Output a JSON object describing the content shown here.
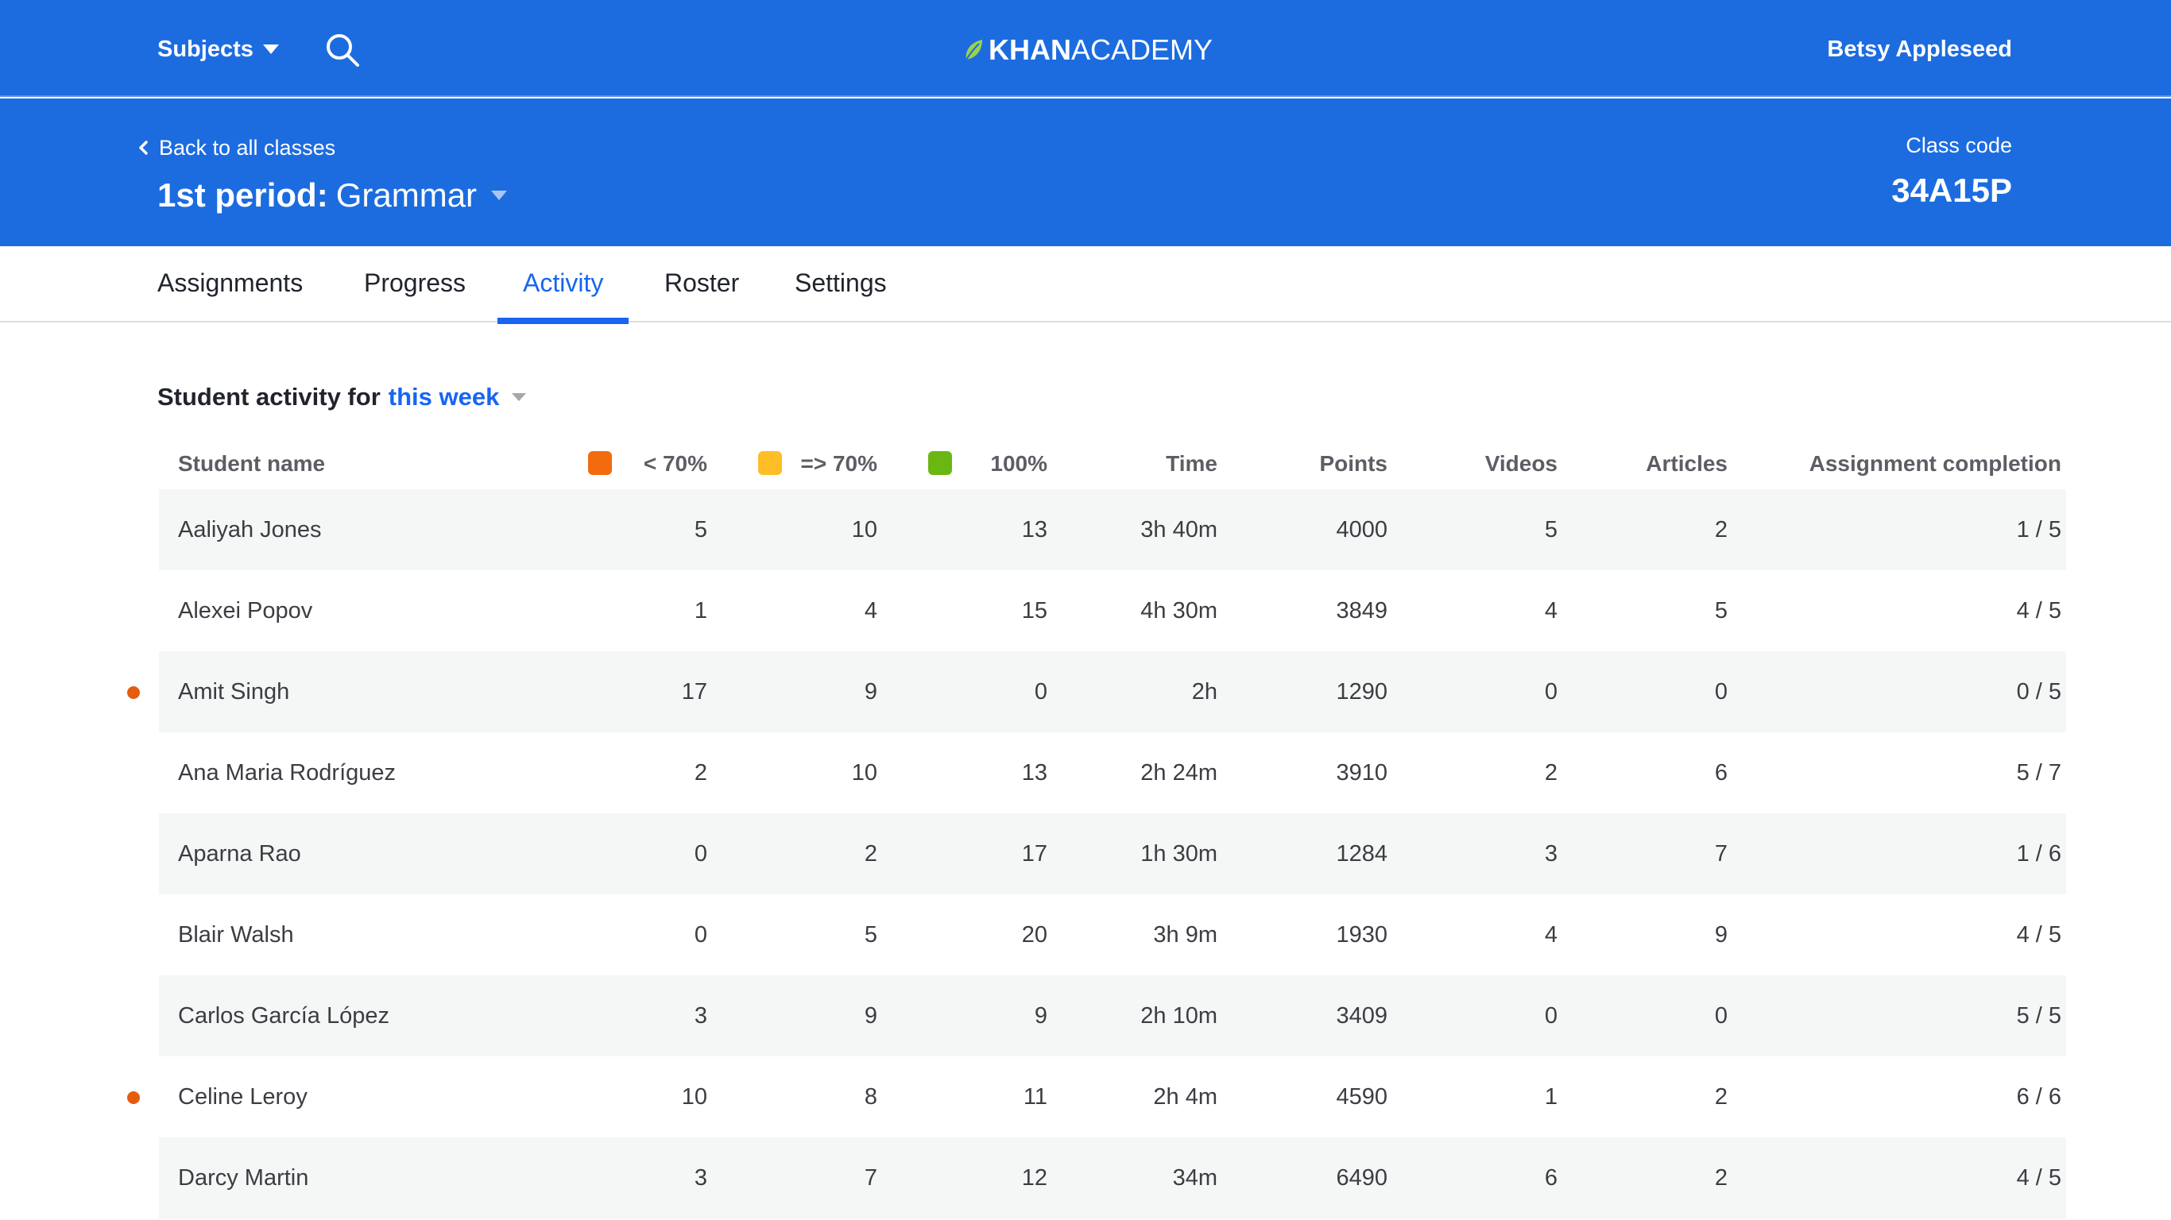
{
  "topbar": {
    "subjects_label": "Subjects",
    "logo_khan": "KHAN",
    "logo_academy": "ACADEMY",
    "user_name": "Betsy Appleseed"
  },
  "class_header": {
    "back_label": "Back to all classes",
    "period": "1st period:",
    "class_name": "Grammar",
    "class_code_label": "Class code",
    "class_code": "34A15P"
  },
  "tabs": [
    {
      "label": "Assignments",
      "active": false
    },
    {
      "label": "Progress",
      "active": false
    },
    {
      "label": "Activity",
      "active": true
    },
    {
      "label": "Roster",
      "active": false
    },
    {
      "label": "Settings",
      "active": false
    }
  ],
  "activity": {
    "title_prefix": "Student activity for",
    "period_value": "this week"
  },
  "colors": {
    "brand_blue": "#1c6ce0",
    "tab_active": "#1865f2",
    "below_70": "#f26b0f",
    "at_or_above_70": "#ffbe26",
    "perfect": "#6ab713",
    "alert_dot": "#e35c10"
  },
  "table": {
    "headers": {
      "student": "Student name",
      "below70": "< 70%",
      "above70": "=> 70%",
      "perfect": "100%",
      "time": "Time",
      "points": "Points",
      "videos": "Videos",
      "articles": "Articles",
      "completion": "Assignment completion"
    },
    "rows": [
      {
        "name": "Aaliyah Jones",
        "below70": "5",
        "above70": "10",
        "perfect": "13",
        "time": "3h 40m",
        "points": "4000",
        "videos": "5",
        "articles": "2",
        "completion": "1 / 5",
        "flagged": false
      },
      {
        "name": "Alexei Popov",
        "below70": "1",
        "above70": "4",
        "perfect": "15",
        "time": "4h 30m",
        "points": "3849",
        "videos": "4",
        "articles": "5",
        "completion": "4 / 5",
        "flagged": false
      },
      {
        "name": "Amit Singh",
        "below70": "17",
        "above70": "9",
        "perfect": "0",
        "time": "2h",
        "points": "1290",
        "videos": "0",
        "articles": "0",
        "completion": "0 / 5",
        "flagged": true
      },
      {
        "name": "Ana Maria Rodríguez",
        "below70": "2",
        "above70": "10",
        "perfect": "13",
        "time": "2h 24m",
        "points": "3910",
        "videos": "2",
        "articles": "6",
        "completion": "5 / 7",
        "flagged": false
      },
      {
        "name": "Aparna Rao",
        "below70": "0",
        "above70": "2",
        "perfect": "17",
        "time": "1h 30m",
        "points": "1284",
        "videos": "3",
        "articles": "7",
        "completion": "1 / 6",
        "flagged": false
      },
      {
        "name": "Blair Walsh",
        "below70": "0",
        "above70": "5",
        "perfect": "20",
        "time": "3h 9m",
        "points": "1930",
        "videos": "4",
        "articles": "9",
        "completion": "4 / 5",
        "flagged": false
      },
      {
        "name": "Carlos García López",
        "below70": "3",
        "above70": "9",
        "perfect": "9",
        "time": "2h 10m",
        "points": "3409",
        "videos": "0",
        "articles": "0",
        "completion": "5 / 5",
        "flagged": false
      },
      {
        "name": "Celine Leroy",
        "below70": "10",
        "above70": "8",
        "perfect": "11",
        "time": "2h 4m",
        "points": "4590",
        "videos": "1",
        "articles": "2",
        "completion": "6 / 6",
        "flagged": true
      },
      {
        "name": "Darcy Martin",
        "below70": "3",
        "above70": "7",
        "perfect": "12",
        "time": "34m",
        "points": "6490",
        "videos": "6",
        "articles": "2",
        "completion": "4 / 5",
        "flagged": false
      }
    ]
  }
}
